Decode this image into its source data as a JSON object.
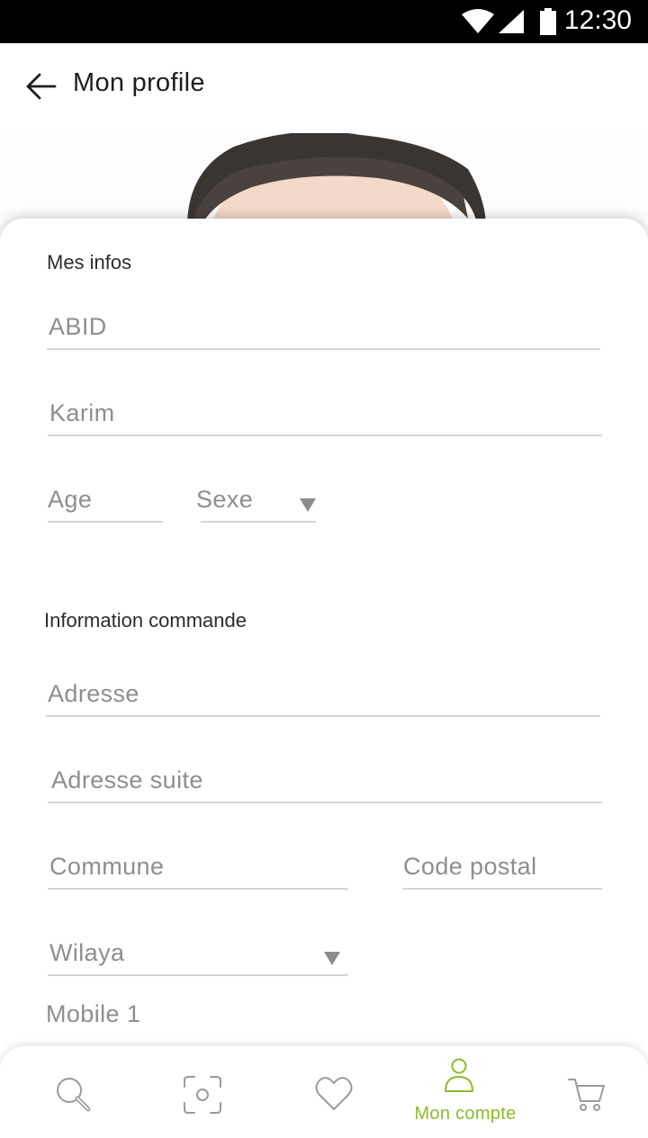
{
  "status_bar": {
    "time": "12:30",
    "icons": [
      "wifi-icon",
      "signal-icon",
      "battery-icon"
    ]
  },
  "app_bar": {
    "back_icon": "arrow-left-icon",
    "title": "Mon profile"
  },
  "form": {
    "mes_infos": {
      "title": "Mes infos",
      "last_name": "ABID",
      "first_name": "Karim",
      "age_placeholder": "Age",
      "sexe_placeholder": "Sexe"
    },
    "commande": {
      "title": "Information commande",
      "adresse_placeholder": "Adresse",
      "adresse_suite_placeholder": "Adresse suite",
      "commune_placeholder": "Commune",
      "code_postal_placeholder": "Code postal",
      "wilaya_placeholder": "Wilaya",
      "mobile_label": "Mobile 1"
    }
  },
  "bottom_nav": {
    "items": [
      {
        "icon": "search-icon",
        "label": "",
        "active": false
      },
      {
        "icon": "scan-icon",
        "label": "",
        "active": false
      },
      {
        "icon": "heart-icon",
        "label": "",
        "active": false
      },
      {
        "icon": "user-icon",
        "label": "Mon compte",
        "active": true
      },
      {
        "icon": "cart-icon",
        "label": "",
        "active": false
      }
    ]
  },
  "colors": {
    "accent": "#8cbd2a",
    "icon_gray": "#9a9a9a",
    "label_gray": "#8e8e8e",
    "underline": "#d6d6d6"
  }
}
